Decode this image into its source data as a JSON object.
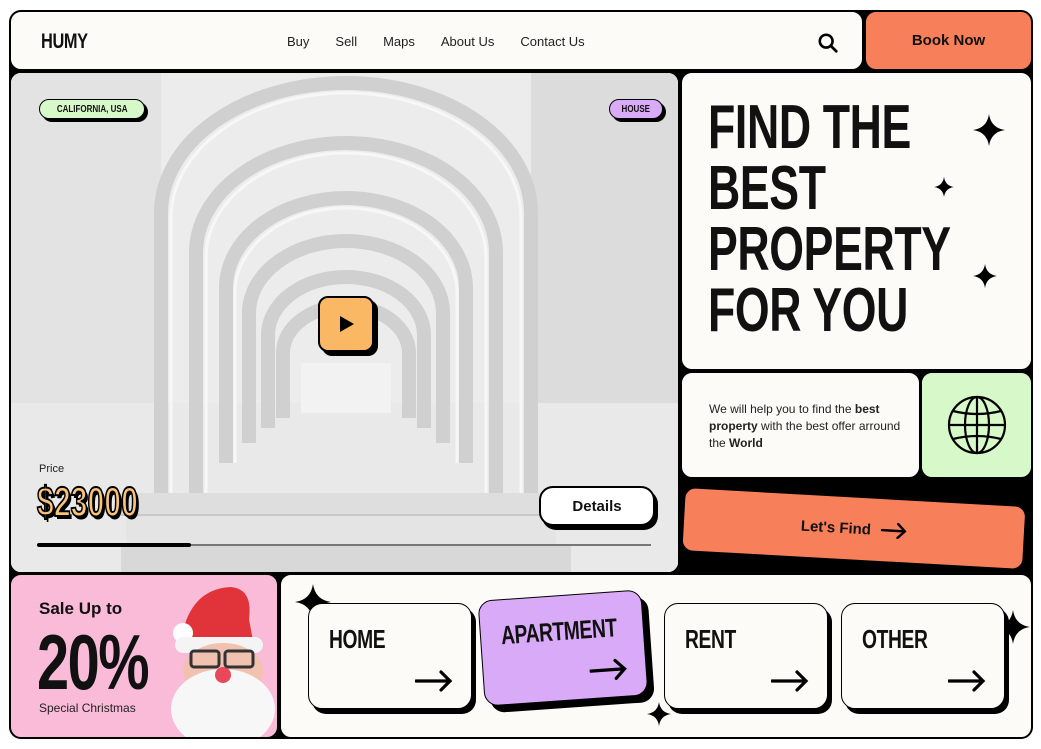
{
  "nav": {
    "logo": "HUMY",
    "links": [
      "Buy",
      "Sell",
      "Maps",
      "About Us",
      "Contact Us"
    ],
    "search_icon": "search-icon",
    "book_label": "Book Now"
  },
  "hero": {
    "location_tag": "CALIFORNIA, USA",
    "type_tag": "HOUSE",
    "price_label": "Price",
    "price": "$23000",
    "details_label": "Details",
    "progress": 0.25
  },
  "headline": {
    "lines": [
      "FIND THE",
      "BEST",
      "PROPERTY",
      "FOR YOU"
    ]
  },
  "info": {
    "t1": "We will help you to find the ",
    "b1": "best property",
    "t2": " with the best offer arround the ",
    "b2": "World"
  },
  "find": {
    "label": "Let's Find"
  },
  "sale": {
    "title": "Sale Up to",
    "percent": "20%",
    "subtitle": "Special Christmas"
  },
  "categories": [
    "HOME",
    "APARTMENT",
    "RENT",
    "OTHER"
  ],
  "colors": {
    "accent": "#f77f59",
    "green": "#d7f8c8",
    "purple": "#d9aaf7",
    "pink": "#f9bbd7",
    "yellow": "#fbb864",
    "cream": "#fcfbf7"
  }
}
